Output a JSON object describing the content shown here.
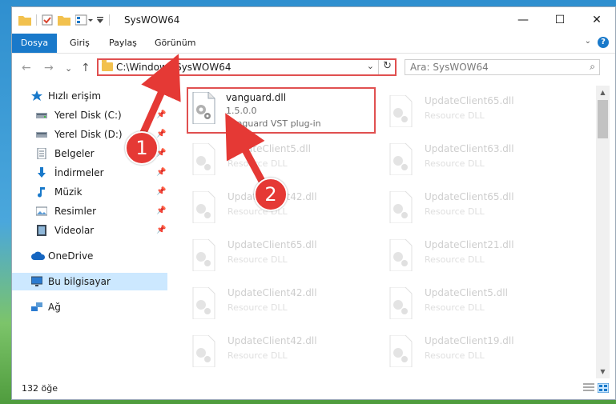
{
  "window": {
    "title": "SysWOW64",
    "minimize": "—",
    "maximize": "☐",
    "close": "✕"
  },
  "ribbon": {
    "tabs": [
      "Dosya",
      "Giriş",
      "Paylaş",
      "Görünüm"
    ],
    "expand": "⌄",
    "help": "?"
  },
  "navbar": {
    "back": "←",
    "forward": "→",
    "recent": "⌄",
    "up": "↑",
    "address": "C:\\Windows\\SysWOW64",
    "address_drop": "⌄",
    "refresh": "↻",
    "search_placeholder": "Ara: SysWOW64",
    "search_icon": "⌕"
  },
  "sidebar": {
    "items": [
      {
        "label": "Hızlı erişim",
        "icon": "star-icon",
        "color": "#1979ca"
      },
      {
        "label": "Yerel Disk (C:)",
        "icon": "drive-icon",
        "pinned": true
      },
      {
        "label": "Yerel Disk (D:)",
        "icon": "drive-icon",
        "pinned": true
      },
      {
        "label": "Belgeler",
        "icon": "documents-icon",
        "pinned": true
      },
      {
        "label": "İndirmeler",
        "icon": "download-icon",
        "pinned": true
      },
      {
        "label": "Müzik",
        "icon": "music-icon",
        "pinned": true
      },
      {
        "label": "Resimler",
        "icon": "pictures-icon",
        "pinned": true
      },
      {
        "label": "Videolar",
        "icon": "videos-icon",
        "pinned": true
      },
      {
        "label": "OneDrive",
        "icon": "cloud-icon"
      },
      {
        "label": "Bu bilgisayar",
        "icon": "computer-icon",
        "selected": true
      },
      {
        "label": "Ağ",
        "icon": "network-icon"
      }
    ],
    "pin_glyph": "📌"
  },
  "files": {
    "highlighted": {
      "name": "vanguard.dll",
      "version": "1.5.0.0",
      "description": "Vanguard VST plug-in"
    },
    "left": [
      {
        "name": "UpdateClient5.dll",
        "type": "Resource DLL"
      },
      {
        "name": "UpdateClient42.dll",
        "type": "Resource DLL"
      },
      {
        "name": "UpdateClient65.dll",
        "type": "Resource DLL"
      },
      {
        "name": "UpdateClient42.dll",
        "type": "Resource DLL"
      },
      {
        "name": "UpdateClient42.dll",
        "type": "Resource DLL"
      }
    ],
    "right": [
      {
        "name": "UpdateClient65.dll",
        "type": "Resource DLL"
      },
      {
        "name": "UpdateClient63.dll",
        "type": "Resource DLL"
      },
      {
        "name": "UpdateClient65.dll",
        "type": "Resource DLL"
      },
      {
        "name": "UpdateClient21.dll",
        "type": "Resource DLL"
      },
      {
        "name": "UpdateClient5.dll",
        "type": "Resource DLL"
      },
      {
        "name": "UpdateClient19.dll",
        "type": "Resource DLL"
      }
    ]
  },
  "status": {
    "count": "132 öğe"
  },
  "annotations": {
    "step1": "1",
    "step2": "2",
    "color": "#e53935"
  }
}
